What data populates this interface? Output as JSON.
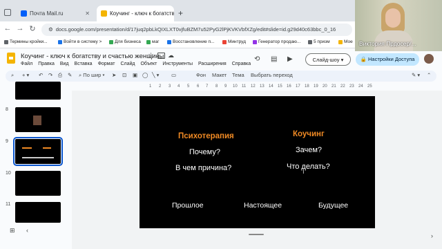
{
  "browser": {
    "tabs": [
      {
        "title": "Почта Mail.ru",
        "color": "#005ff9",
        "active": false
      },
      {
        "title": "Коучинг - ключ к богатству и с",
        "color": "#f4b400",
        "active": true
      }
    ],
    "new_tab": "+",
    "url": "docs.google.com/presentation/d/17juq2pbLkQIXLXT0vjfuBZM7u52PyG2lPjKVKVbfXZg/edit#slide=id.g29d40c63bbc_0_16",
    "bookmarks": [
      {
        "label": "Термины кройки...",
        "color": "#5f6368"
      },
      {
        "label": "Войти в систему >",
        "color": "#1a73e8"
      },
      {
        "label": "Для бизнеса",
        "color": "#34a853"
      },
      {
        "label": "маг",
        "color": "#34a853"
      },
      {
        "label": "Восстановление п...",
        "color": "#1a73e8"
      },
      {
        "label": "Минтруд",
        "color": "#ea4335"
      },
      {
        "label": "Генератор продаю...",
        "color": "#9334e6"
      },
      {
        "label": "5 призм",
        "color": "#5f6368"
      },
      {
        "label": "Мое",
        "color": "#f4b400"
      }
    ]
  },
  "docs": {
    "title": "Коучинг - ключ к богатству и счастью женщины",
    "menu": [
      "Файл",
      "Правка",
      "Вид",
      "Вставка",
      "Формат",
      "Слайд",
      "Объект",
      "Инструменты",
      "Расширения",
      "Справка"
    ],
    "slideshow_button": "Слайд-шоу",
    "share_button": "Настройки Доступа",
    "toolbar": {
      "zoom": "По шир",
      "background": "Фон",
      "layout": "Макет",
      "theme": "Тема",
      "transition": "Выбрать переход"
    },
    "ruler_ticks": [
      "1",
      "2",
      "3",
      "4",
      "5",
      "6",
      "7",
      "8",
      "9",
      "10",
      "11",
      "12",
      "13",
      "14",
      "15",
      "16",
      "17",
      "18",
      "19",
      "20",
      "21",
      "22",
      "23",
      "24",
      "25"
    ]
  },
  "filmstrip": {
    "slides": [
      {
        "number": "",
        "selected": false
      },
      {
        "number": "8",
        "selected": false
      },
      {
        "number": "9",
        "selected": true
      },
      {
        "number": "10",
        "selected": false
      },
      {
        "number": "11",
        "selected": false
      }
    ]
  },
  "slide": {
    "left_heading": "Психотерапия",
    "left_line1": "Почему?",
    "left_line2": "В чем причина?",
    "right_heading": "Коучинг",
    "right_line1": "Зачем?",
    "right_line2": "Что делать?",
    "bottom_left": "Прошлое",
    "bottom_center": "Настоящее",
    "bottom_right": "Будущее",
    "accent_color": "#f08a24"
  },
  "webcam": {
    "name": "Виктория Прдосер/..."
  }
}
